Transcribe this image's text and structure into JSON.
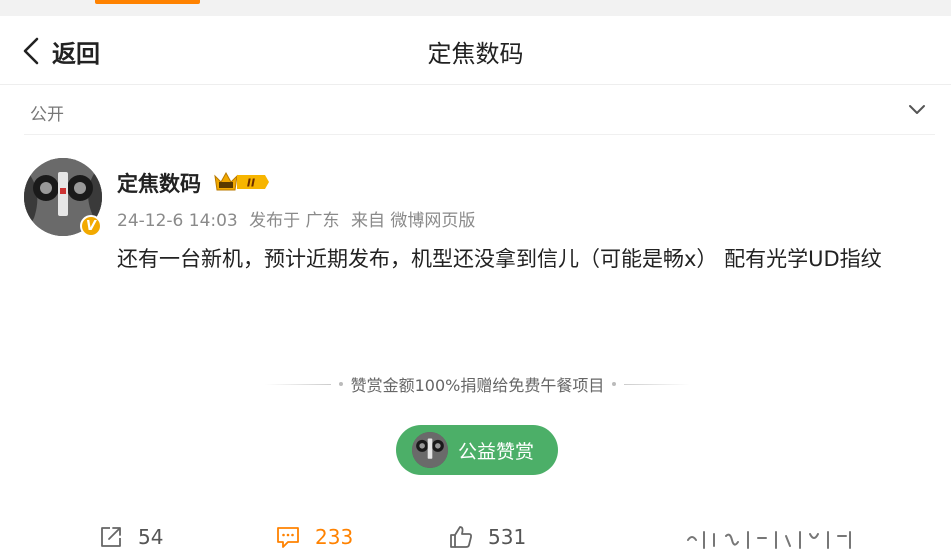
{
  "header": {
    "back_label": "返回",
    "title": "定焦数码"
  },
  "visibility": {
    "label": "公开"
  },
  "post": {
    "username": "定焦数码",
    "member_badge": "II",
    "verified_badge": "V",
    "time": "24-12-6 14:03",
    "location": "发布于 广东",
    "source": "来自 微博网页版",
    "text": "还有一台新机，预计近期发布，机型还没拿到信儿（可能是畅x） 配有光学UD指纹"
  },
  "reward": {
    "notice": "赞赏金额100%捐赠给免费午餐项目",
    "button_label": "公益赞赏"
  },
  "actions": {
    "reposts": "54",
    "comments": "233",
    "likes": "531"
  },
  "colors": {
    "accent": "#ff8200",
    "charity_green": "#4caf68",
    "vip_gold": "#f2a900"
  }
}
